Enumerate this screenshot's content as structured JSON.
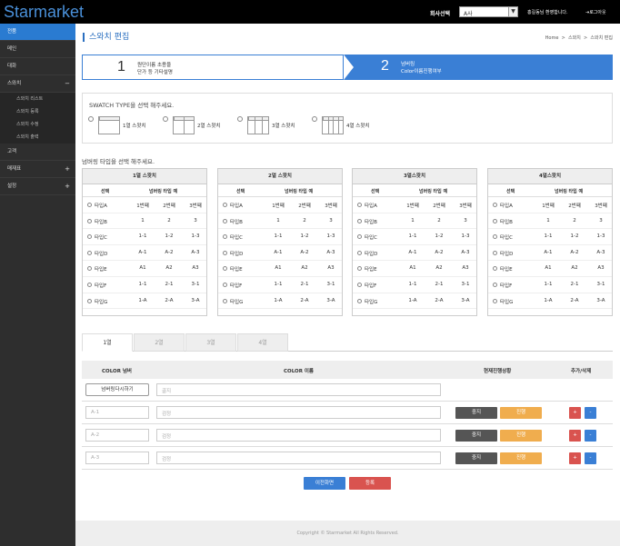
{
  "app": {
    "logo": "Starmarket",
    "company_label": "회사선택",
    "company_value": "A사",
    "welcome": "홍길동님 환영합니다.",
    "logout": "로그아웃"
  },
  "sidebar": {
    "items": [
      {
        "label": "전품",
        "active": true
      },
      {
        "label": "메인"
      },
      {
        "label": "대화"
      },
      {
        "label": "스와치",
        "sign": "−",
        "subs": [
          "스와치 리스트",
          "스와치 등록",
          "스와치 수정",
          "스와치 출력"
        ]
      },
      {
        "label": "고객"
      },
      {
        "label": "매재표",
        "sign": "+"
      },
      {
        "label": "설정",
        "sign": "+"
      }
    ]
  },
  "page": {
    "title": "스와치 편집",
    "breadcrumb": [
      "Home",
      ">",
      "스와치",
      ">",
      "스와치 편집"
    ]
  },
  "steps": [
    {
      "num": "1",
      "line1": "원단이름 초용을",
      "line2": "단가 등 기타설명"
    },
    {
      "num": "2",
      "line1": "넘버링",
      "line2": "Color이름진행여부"
    }
  ],
  "swatch": {
    "question": "SWATCH TYPE을 선택 해주세요.",
    "options": [
      "1열 스왓치",
      "2열 스왓치",
      "3열 스왓치",
      "4열 스왓치"
    ]
  },
  "numbering": {
    "question": "넘버링 타입을 선택 해주세요.",
    "tables": [
      "1열 스왓치",
      "2열 스왓치",
      "3열스왓치",
      "4열스왓치"
    ],
    "sub": {
      "select": "선택",
      "example": "넘버링 타입 예",
      "cols": [
        "1번째",
        "2번째",
        "3번째"
      ]
    },
    "rows": [
      {
        "name": "타입A",
        "vals": [
          "1번째",
          "2번째",
          "3번째"
        ]
      },
      {
        "name": "타입B",
        "vals": [
          "1",
          "2",
          "3"
        ]
      },
      {
        "name": "타입C",
        "vals": [
          "1-1",
          "1-2",
          "1-3"
        ]
      },
      {
        "name": "타입D",
        "vals": [
          "A-1",
          "A-2",
          "A-3"
        ]
      },
      {
        "name": "타입E",
        "vals": [
          "A1",
          "A2",
          "A3"
        ]
      },
      {
        "name": "타입F",
        "vals": [
          "1-1",
          "2-1",
          "3-1"
        ]
      },
      {
        "name": "타입G",
        "vals": [
          "1-A",
          "2-A",
          "3-A"
        ]
      }
    ]
  },
  "color_tabs": [
    "1열",
    "2열",
    "3열",
    "4열"
  ],
  "color_table": {
    "headers": [
      "COLOR 넘버",
      "COLOR 이름",
      "현재진행상황",
      "추가/삭제"
    ],
    "renumber": "넘버링다시하기",
    "name_ph_first": "골지",
    "rows": [
      {
        "num": "A-1",
        "name": "검정"
      },
      {
        "num": "A-2",
        "name": "검정"
      },
      {
        "num": "A-3",
        "name": "검정"
      }
    ],
    "stop": "중지",
    "go": "진행",
    "plus": "+",
    "minus": "-"
  },
  "actions": {
    "prev": "이전화면",
    "register": "등록"
  },
  "footer": "Copyright © Starmarket All Rights Reserved."
}
